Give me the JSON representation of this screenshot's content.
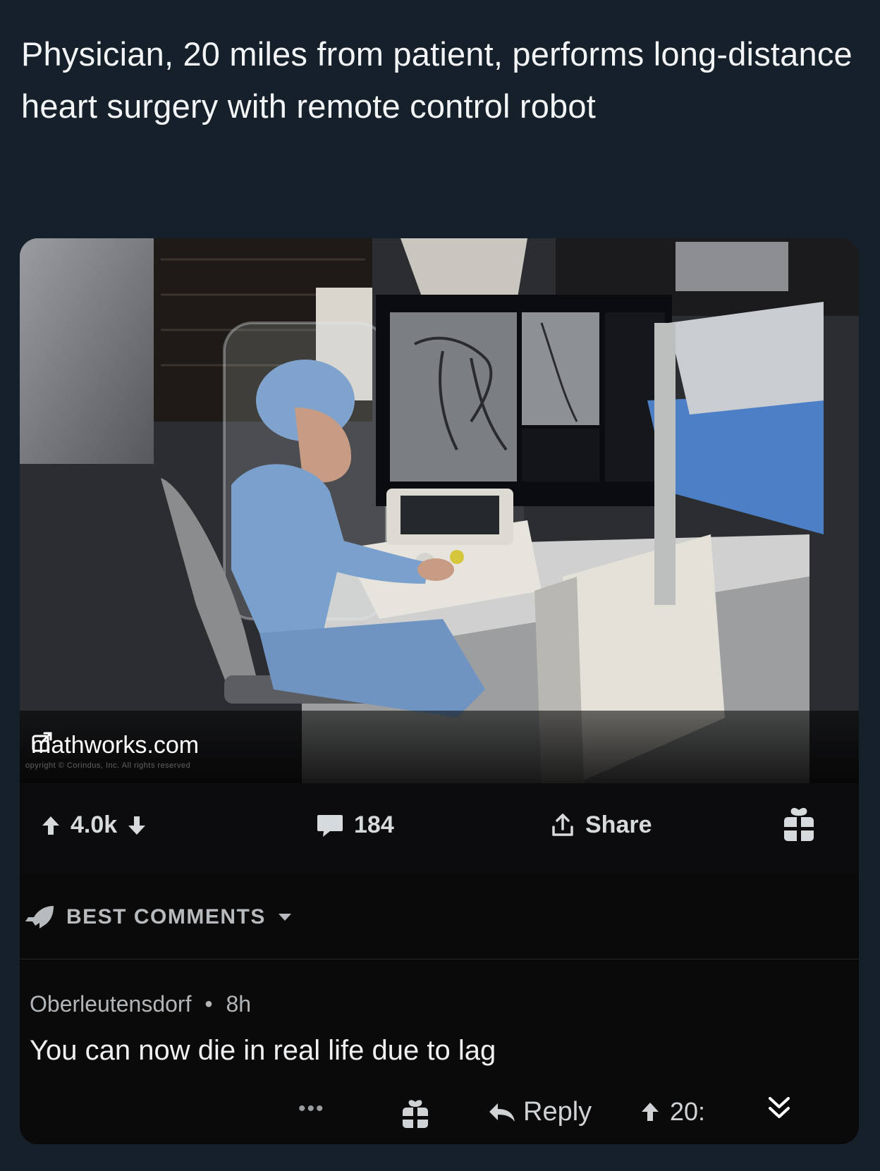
{
  "tweet": {
    "text": "Physician, 20 miles from patient, performs long-distance heart surgery with remote control robot"
  },
  "card": {
    "source": "mathworks.com",
    "copyright": "opyright © Corindus, Inc. All rights reserved",
    "upvotes": "4.0k",
    "comments": "184",
    "share_label": "Share",
    "sort_label": "BEST COMMENTS",
    "comment": {
      "author": "Oberleutensdorf",
      "separator": "•",
      "age": "8h",
      "body": "You can now die in real life due to lag",
      "more": "•••",
      "reply_label": "Reply",
      "score": "20:"
    }
  },
  "icons": {
    "external": "external-link-icon",
    "upvote": "upvote-arrow-icon",
    "downvote": "downvote-arrow-icon",
    "comment": "comment-bubble-icon",
    "share": "share-icon",
    "award": "gift-award-icon",
    "rocket": "rocket-icon",
    "caret": "caret-down-icon",
    "reply": "reply-arrow-icon",
    "collapse": "double-chevron-down-icon"
  },
  "colors": {
    "background": "#16202b",
    "card": "#000000",
    "text": "#ffffff"
  }
}
